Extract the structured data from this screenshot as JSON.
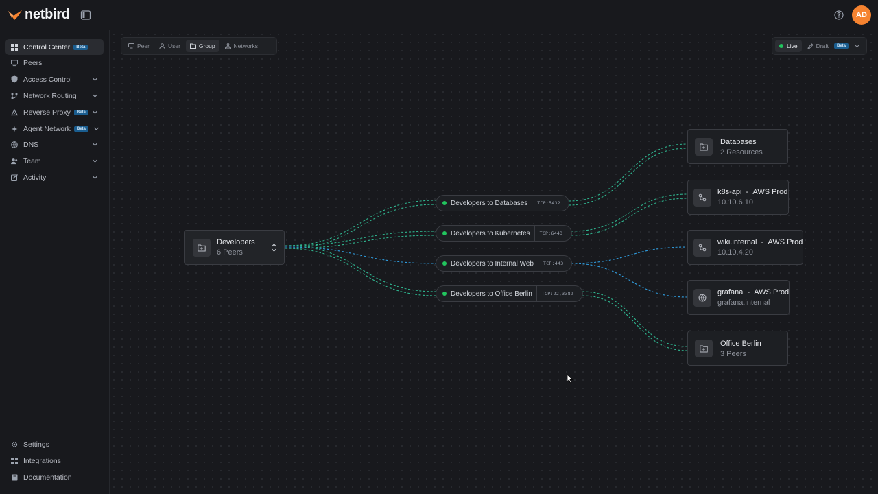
{
  "app": {
    "brand": "netbird",
    "avatar_initials": "AD"
  },
  "colors": {
    "accent_orange": "#f68330",
    "status_green": "#22c55e",
    "edge_green": "#2fb58f",
    "edge_blue": "#2f9bdc",
    "beta_badge": "#1a5d8f"
  },
  "sidebar": {
    "items": [
      {
        "label": "Control Center",
        "icon": "grid-icon",
        "badge": "Beta",
        "active": true
      },
      {
        "label": "Peers",
        "icon": "monitor-icon"
      },
      {
        "label": "Access Control",
        "icon": "shield-icon",
        "expandable": true
      },
      {
        "label": "Network Routing",
        "icon": "network-icon",
        "expandable": true
      },
      {
        "label": "Reverse Proxy",
        "icon": "proxy-icon",
        "badge": "Beta",
        "expandable": true
      },
      {
        "label": "Agent Network",
        "icon": "sparkle-icon",
        "badge": "Beta",
        "expandable": true
      },
      {
        "label": "DNS",
        "icon": "globe-icon",
        "expandable": true
      },
      {
        "label": "Team",
        "icon": "users-icon",
        "expandable": true
      },
      {
        "label": "Activity",
        "icon": "activity-icon",
        "expandable": true
      }
    ],
    "bottom": [
      {
        "label": "Settings",
        "icon": "gear-icon"
      },
      {
        "label": "Integrations",
        "icon": "puzzle-icon"
      },
      {
        "label": "Documentation",
        "icon": "book-icon"
      }
    ]
  },
  "view_tabs": [
    {
      "label": "Peer",
      "icon": "peer-icon"
    },
    {
      "label": "User",
      "icon": "user-icon"
    },
    {
      "label": "Group",
      "icon": "folder-icon",
      "active": true
    },
    {
      "label": "Networks",
      "icon": "networks-icon"
    }
  ],
  "mode": {
    "live": "Live",
    "draft": "Draft",
    "draft_badge": "Beta"
  },
  "source": {
    "title": "Developers",
    "subtitle": "6 Peers"
  },
  "policies": [
    {
      "label": "Developers to Databases",
      "port": "TCP:5432"
    },
    {
      "label": "Developers to Kubernetes",
      "port": "TCP:6443"
    },
    {
      "label": "Developers to Internal Web",
      "port": "TCP:443"
    },
    {
      "label": "Developers to Office Berlin",
      "port": "TCP:22,3389"
    }
  ],
  "destinations": [
    {
      "name": "Databases",
      "network": "",
      "detail": "2 Resources",
      "icon": "folder-icon"
    },
    {
      "name": "k8s-api",
      "network": "AWS Prod",
      "detail": "10.10.6.10",
      "icon": "route-icon"
    },
    {
      "name": "wiki.internal",
      "network": "AWS Prod",
      "detail": "10.10.4.20",
      "icon": "route-icon"
    },
    {
      "name": "grafana",
      "network": "AWS Prod",
      "detail": "grafana.internal",
      "icon": "globe-icon"
    },
    {
      "name": "Office Berlin",
      "network": "",
      "detail": "3 Peers",
      "icon": "folder-icon"
    }
  ],
  "separator": "-"
}
